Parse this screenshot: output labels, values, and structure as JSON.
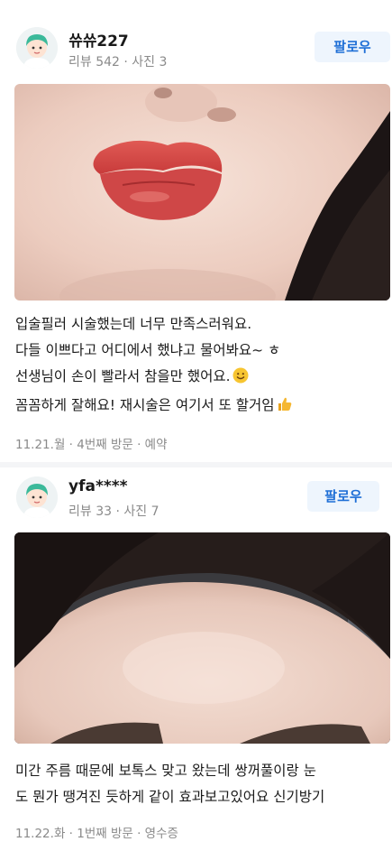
{
  "reviews": [
    {
      "user": {
        "name": "쓔쓔227",
        "stats": "리뷰 542 · 사진 3"
      },
      "follow_label": "팔로우",
      "lines": [
        "입술필러 시술했는데 너무 만족스러워요.",
        "다들 이쁘다고 어디에서 했냐고 물어봐요~ ㅎ",
        "선생님이 손이 빨라서 참을만 했어요.",
        "꼼꼼하게 잘해요! 재시술은 여기서 또 할거임"
      ],
      "line_emojis": [
        "",
        "",
        "smiling-face-emoji",
        "thumbs-up-emoji"
      ],
      "meta": "11.21.월 · 4번째 방문 · 예약"
    },
    {
      "user": {
        "name": "yfa****",
        "stats": "리뷰 33 · 사진 7"
      },
      "follow_label": "팔로우",
      "lines": [
        "미간 주름 때문에 보톡스 맞고 왔는데 쌍꺼풀이랑 눈",
        "도 뭔가 땡겨진 듯하게 같이 효과보고있어요 신기방기"
      ],
      "meta": "11.22.화 · 1번째 방문 · 영수증"
    }
  ],
  "colors": {
    "accent": "#1f6fd6",
    "follow_bg": "#eef5fd",
    "muted_text": "#8a8a8a"
  },
  "icons": {
    "avatar": "default-avatar-icon"
  }
}
